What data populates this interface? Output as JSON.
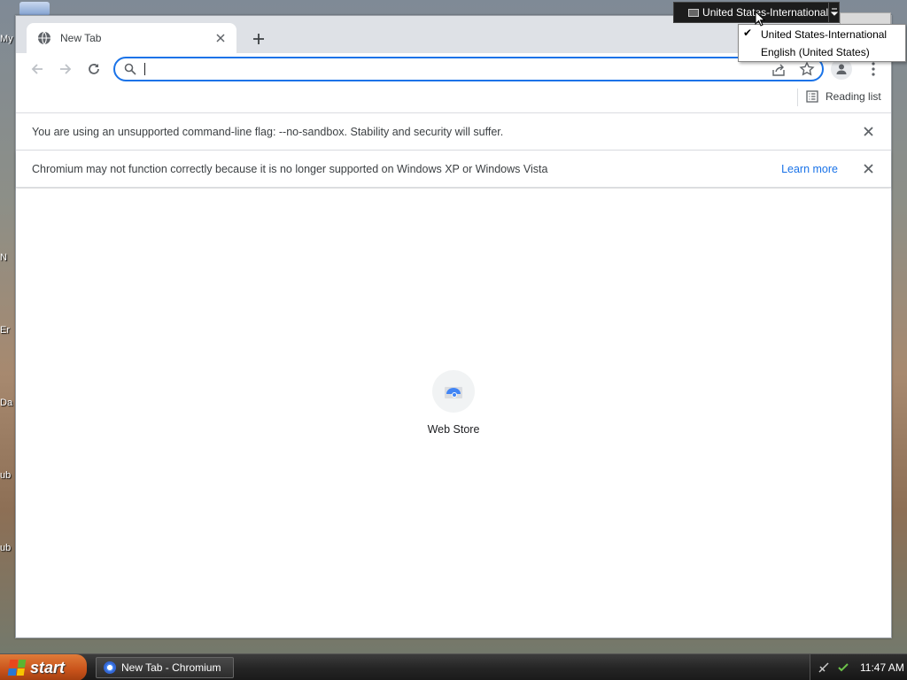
{
  "desktop": {
    "labels": [
      "My",
      "N",
      "Er",
      "Da",
      "ub",
      "ub"
    ]
  },
  "browser": {
    "tab": {
      "title": "New Tab"
    },
    "reading_list": "Reading list",
    "infobars": [
      {
        "message": "You are using an unsupported command-line flag: --no-sandbox. Stability and security will suffer.",
        "link": ""
      },
      {
        "message": "Chromium may not function correctly because it is no longer supported on Windows XP or Windows Vista",
        "link": "Learn more"
      }
    ],
    "shortcut": {
      "label": "Web Store"
    },
    "accent_color": "#1a73e8"
  },
  "language_bar": {
    "current": "United States-International",
    "menu": [
      {
        "label": "United States-International",
        "checked": true
      },
      {
        "label": "English (United States)",
        "checked": false
      }
    ]
  },
  "taskbar": {
    "start_label": "start",
    "task_label": "New Tab - Chromium",
    "clock": "11:47 AM"
  }
}
